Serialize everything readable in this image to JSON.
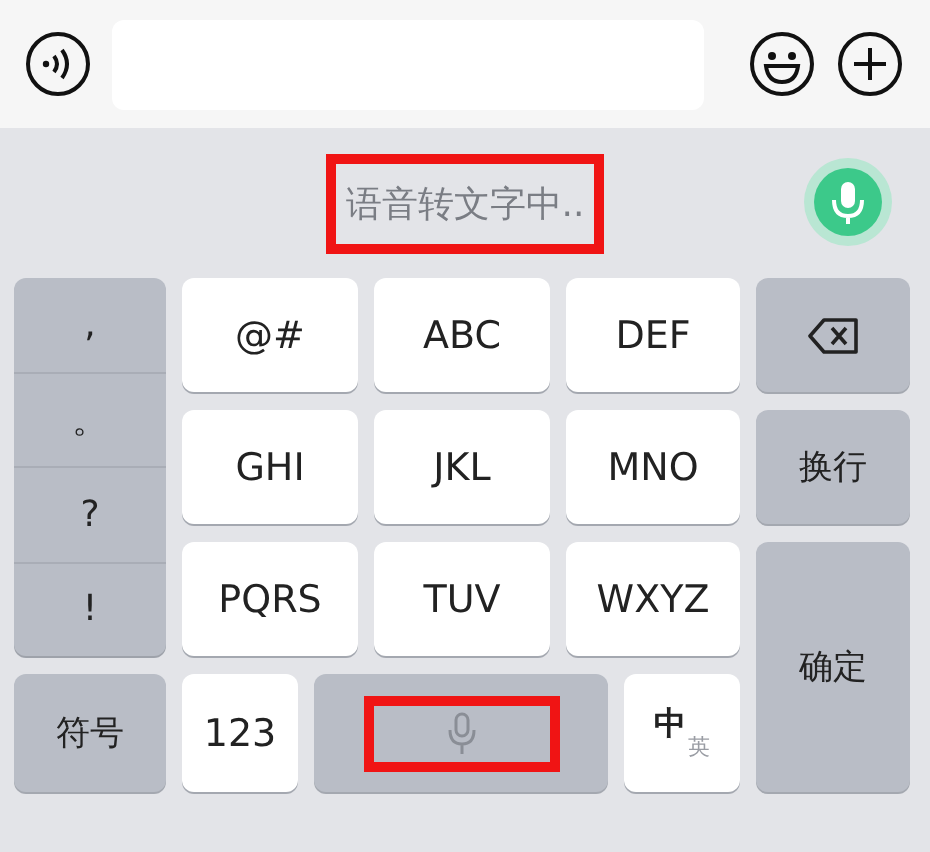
{
  "voice_status": {
    "text": "语音转文字中..",
    "highlighted": true,
    "mic_active": true
  },
  "punctuation": [
    ",",
    "。",
    "?",
    "!"
  ],
  "letter_keys": [
    "@#",
    "ABC",
    "DEF",
    "GHI",
    "JKL",
    "MNO",
    "PQRS",
    "TUV",
    "WXYZ"
  ],
  "side_keys": [
    {
      "kind": "backspace"
    },
    {
      "kind": "text",
      "label": "换行"
    },
    {
      "kind": "text",
      "label": "确定"
    }
  ],
  "bottom_keys": [
    {
      "kind": "text",
      "label": "符号"
    },
    {
      "kind": "text",
      "label": "123"
    },
    {
      "kind": "space",
      "highlighted": true
    },
    {
      "kind": "lang",
      "primary": "中",
      "secondary": "英"
    }
  ]
}
